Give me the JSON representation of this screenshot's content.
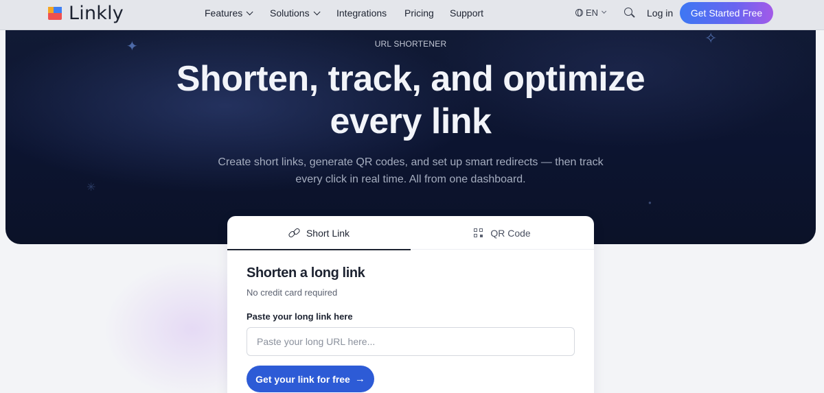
{
  "nav": {
    "brand": "Linkly",
    "items": [
      {
        "label": "Features",
        "has_dropdown": true
      },
      {
        "label": "Solutions",
        "has_dropdown": true
      },
      {
        "label": "Integrations",
        "has_dropdown": false
      },
      {
        "label": "Pricing",
        "has_dropdown": false
      },
      {
        "label": "Support",
        "has_dropdown": false
      }
    ],
    "language": "EN",
    "login_label": "Log in",
    "cta_label": "Get Started Free"
  },
  "hero": {
    "eyebrow": "URL SHORTENER",
    "headline_line1": "Shorten, track, and optimize",
    "headline_line2": "every link",
    "subtext_line1": "Create short links, generate QR codes, and set up smart redirects — then track",
    "subtext_line2": "every click in real time. All from one dashboard."
  },
  "card": {
    "tabs": [
      {
        "label": "Short Link",
        "icon": "link-icon",
        "active": true
      },
      {
        "label": "QR Code",
        "icon": "qr-code-icon",
        "active": false
      }
    ],
    "title": "Shorten a long link",
    "subtitle": "No credit card required",
    "field_label": "Paste your long link here",
    "input_value": "",
    "input_placeholder": "Paste your long URL here...",
    "submit_label": "Get your link for free"
  },
  "colors": {
    "hero_bg": "#0c1430",
    "cta_gradient_start": "#3d77f3",
    "cta_gradient_end": "#a35ae8",
    "primary_button": "#2d5bd6"
  }
}
